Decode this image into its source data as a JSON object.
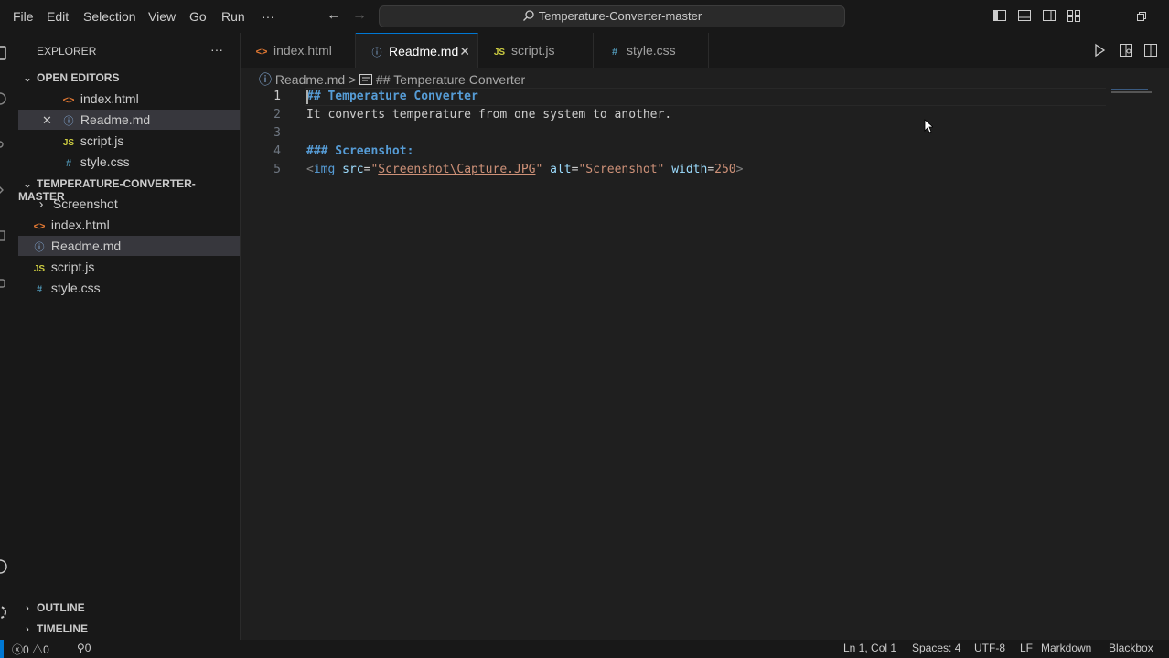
{
  "menu": [
    "File",
    "Edit",
    "Selection",
    "View",
    "Go",
    "Run",
    "···"
  ],
  "command_center": "Temperature-Converter-master",
  "sidebar": {
    "title": "EXPLORER",
    "more": "···",
    "open_editors_title": "OPEN EDITORS",
    "open_editors": [
      {
        "name": "index.html",
        "icon": "html-icon"
      },
      {
        "name": "Readme.md",
        "icon": "info-icon"
      },
      {
        "name": "script.js",
        "icon": "js-icon"
      },
      {
        "name": "style.css",
        "icon": "css-icon"
      }
    ],
    "folder_title": "TEMPERATURE-CONVERTER-MASTER",
    "files": [
      {
        "name": "Screenshot",
        "icon": "folder-chevron"
      },
      {
        "name": "index.html",
        "icon": "html-icon"
      },
      {
        "name": "Readme.md",
        "icon": "info-icon"
      },
      {
        "name": "script.js",
        "icon": "js-icon"
      },
      {
        "name": "style.css",
        "icon": "css-icon"
      }
    ],
    "outline_title": "OUTLINE",
    "timeline_title": "TIMELINE"
  },
  "icons": {
    "html": "<>",
    "info": "ⓘ",
    "js": "JS",
    "css": "#",
    "chev_down": "⌄",
    "chev_right": "›",
    "close": "✕"
  },
  "tabs": [
    {
      "label": "index.html",
      "icon": "html-icon"
    },
    {
      "label": "Readme.md",
      "icon": "info-icon",
      "active": true
    },
    {
      "label": "script.js",
      "icon": "js-icon"
    },
    {
      "label": "style.css",
      "icon": "css-icon"
    }
  ],
  "breadcrumb": {
    "file": "Readme.md",
    "sep": ">",
    "symbol": "## Temperature Converter"
  },
  "editor": {
    "lines": [
      {
        "n": "1",
        "parts": [
          [
            "h",
            "## Temperature Converter"
          ]
        ]
      },
      {
        "n": "2",
        "parts": [
          [
            "t",
            "It converts temperature from one system to another."
          ]
        ]
      },
      {
        "n": "3",
        "parts": []
      },
      {
        "n": "4",
        "parts": [
          [
            "h",
            "### Screenshot:"
          ]
        ]
      },
      {
        "n": "5",
        "parts": [
          [
            "tag",
            "<"
          ],
          [
            "tagname",
            "img"
          ],
          [
            "t",
            " "
          ],
          [
            "attr",
            "src"
          ],
          [
            "t",
            "="
          ],
          [
            "str",
            "\""
          ],
          [
            "link",
            "Screenshot\\Capture.JPG"
          ],
          [
            "str",
            "\""
          ],
          [
            "t",
            " "
          ],
          [
            "attr",
            "alt"
          ],
          [
            "t",
            "="
          ],
          [
            "str",
            "\"Screenshot\""
          ],
          [
            "t",
            " "
          ],
          [
            "attr",
            "width"
          ],
          [
            "t",
            "="
          ],
          [
            "str",
            "250"
          ],
          [
            "tag",
            ">"
          ]
        ]
      }
    ]
  },
  "status": {
    "errors": "0",
    "warnings": "0",
    "ports": "0",
    "position": "Ln 1, Col 1",
    "spaces": "Spaces: 4",
    "encoding": "UTF-8",
    "eol": "LF",
    "language": "Markdown",
    "extension": "Blackbox"
  },
  "colors": {
    "accent": "#0078d4",
    "heading": "#569cd6",
    "string": "#ce9178"
  }
}
